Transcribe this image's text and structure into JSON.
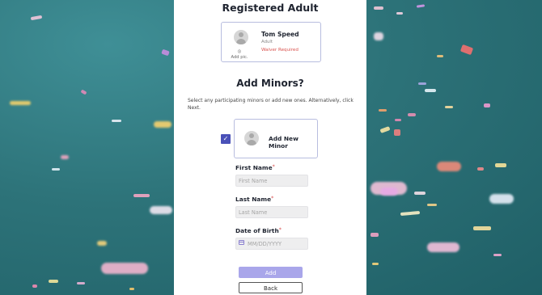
{
  "registered": {
    "title": "Registered Adult",
    "name": "Tom Speed",
    "role": "Adult",
    "waiver_status": "Waiver Required",
    "add_pic_label": "Add pic."
  },
  "minors": {
    "heading": "Add Minors?",
    "instructions": "Select any participating minors or add new ones. Alternatively, click Next.",
    "add_new_label": "Add New Minor",
    "add_new_checked": true
  },
  "form": {
    "first_name": {
      "label": "First Name",
      "placeholder": "First Name",
      "value": ""
    },
    "last_name": {
      "label": "Last Name",
      "placeholder": "Last Name",
      "value": ""
    },
    "dob": {
      "label": "Date of Birth",
      "placeholder": "MM/DD/YYYY",
      "value": ""
    },
    "required_mark": "*"
  },
  "actions": {
    "add_label": "Add",
    "back_label": "Back"
  },
  "colors": {
    "accent": "#4a51b8",
    "add_button": "#a9a6ea",
    "waiver": "#d9534f",
    "card_border": "#b8bddf"
  },
  "icons": {
    "avatar": "person-placeholder-icon",
    "camera": "camera-icon",
    "checkbox": "checkmark-icon",
    "calendar": "calendar-icon"
  }
}
